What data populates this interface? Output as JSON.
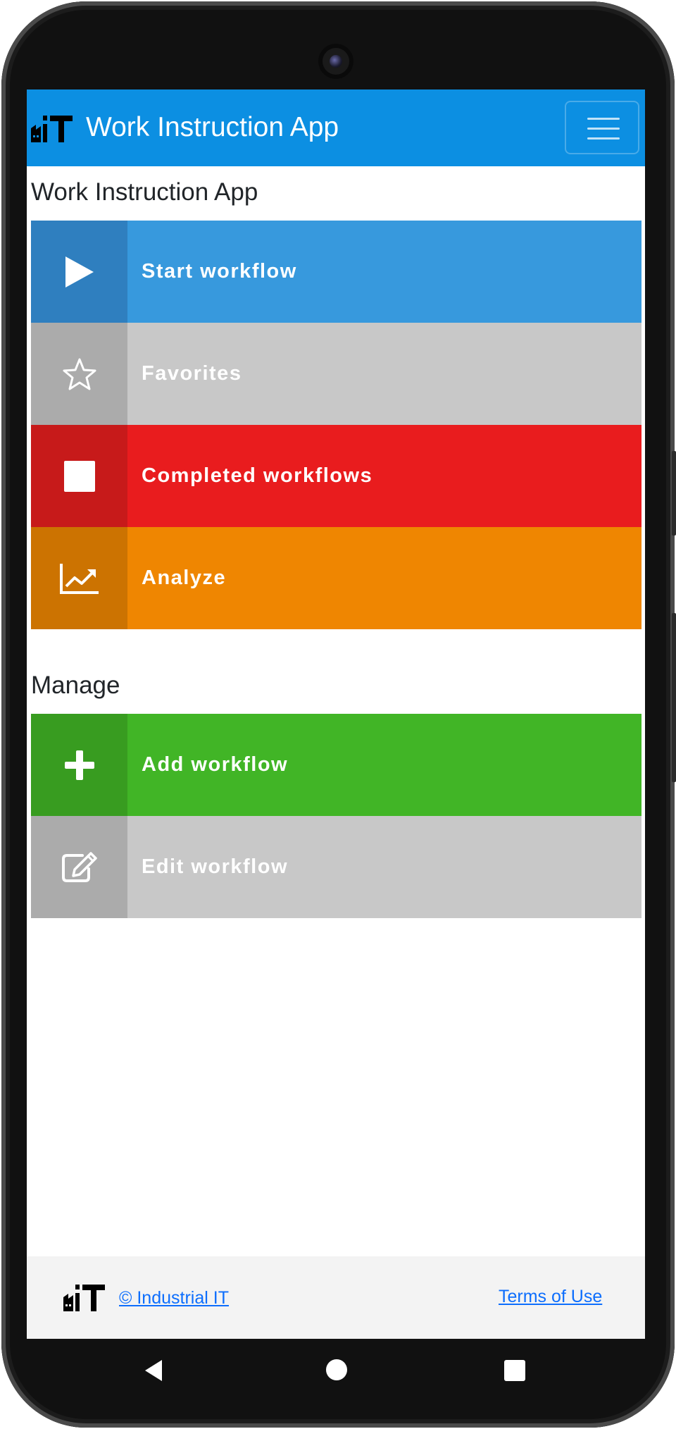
{
  "app": {
    "title": "Work Instruction App"
  },
  "navbar": {
    "brand_title": "Work Instruction App",
    "menu_icon": "hamburger-icon"
  },
  "main": {
    "section_title": "Work Instruction App",
    "tiles": [
      {
        "label": "Start workflow",
        "icon": "play-icon",
        "color": "#3799dd",
        "icon_bg": "#2f7fbf"
      },
      {
        "label": "Favorites",
        "icon": "star-icon",
        "color": "#c8c8c8",
        "icon_bg": "#ababab"
      },
      {
        "label": "Completed workflows",
        "icon": "stop-icon",
        "color": "#e91c1e",
        "icon_bg": "#c71a1a"
      },
      {
        "label": "Analyze",
        "icon": "chart-line-icon",
        "color": "#ef8601",
        "icon_bg": "#cc7301"
      }
    ]
  },
  "manage": {
    "section_title": "Manage",
    "tiles": [
      {
        "label": "Add workflow",
        "icon": "plus-icon",
        "color": "#41b526",
        "icon_bg": "#389c20"
      },
      {
        "label": "Edit workflow",
        "icon": "edit-icon",
        "color": "#c8c8c8",
        "icon_bg": "#ababab"
      }
    ]
  },
  "footer": {
    "copyright_link": "© Industrial IT",
    "terms_link": "Terms of Use"
  },
  "colors": {
    "navbar": "#0c8fe2",
    "footer_bg": "#f3f3f3",
    "link": "#0d6efd"
  }
}
